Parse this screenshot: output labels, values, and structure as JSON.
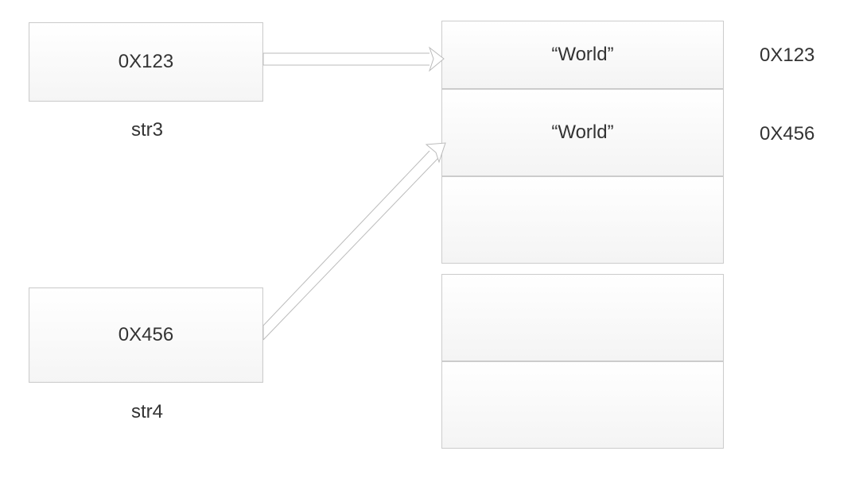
{
  "left_boxes": [
    {
      "value": "0X123",
      "label": "str3"
    },
    {
      "value": "0X456",
      "label": "str4"
    }
  ],
  "memory_cells": [
    {
      "value": "“World”",
      "address": "0X123"
    },
    {
      "value": "“World”",
      "address": "0X456"
    },
    {
      "value": "",
      "address": ""
    },
    {
      "value": "",
      "address": ""
    },
    {
      "value": "",
      "address": ""
    }
  ]
}
